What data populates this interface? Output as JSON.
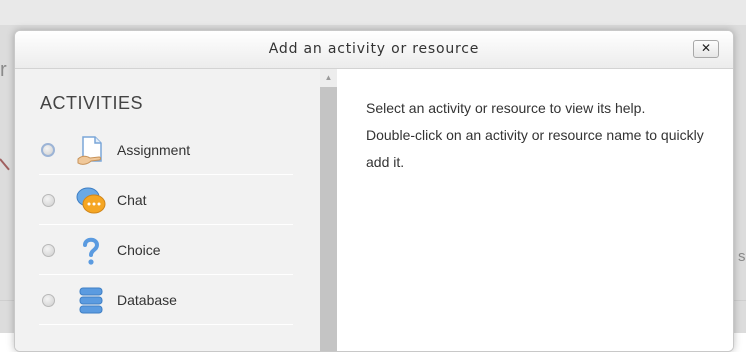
{
  "background": {
    "left_fragment": "r",
    "right_fragment": "s"
  },
  "dialog": {
    "title": "Add an activity or resource",
    "close_label": "✕"
  },
  "options": {
    "section_title": "ACTIVITIES",
    "items": [
      {
        "label": "Assignment",
        "icon": "assignment-icon",
        "selected": true
      },
      {
        "label": "Chat",
        "icon": "chat-icon",
        "selected": false
      },
      {
        "label": "Choice",
        "icon": "choice-icon",
        "selected": false
      },
      {
        "label": "Database",
        "icon": "database-icon",
        "selected": false
      }
    ]
  },
  "scrollbar": {
    "up_arrow": "▲"
  },
  "help": {
    "line1": "Select an activity or resource to view its help.",
    "line2": "Double-click on an activity or resource name to quickly add it."
  },
  "colors": {
    "accent": "#4a90d9",
    "chat_orange": "#f5a623",
    "panel": "#f2f2f2"
  }
}
